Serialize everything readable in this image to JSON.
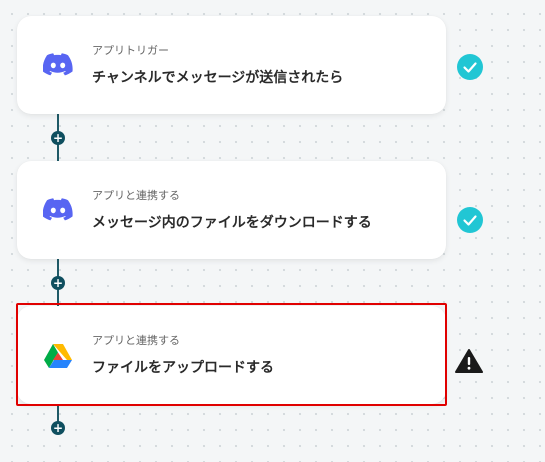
{
  "steps": [
    {
      "kind": "アプリトリガー",
      "title": "チャンネルでメッセージが送信されたら",
      "app_icon": "discord-icon",
      "status": "check-icon"
    },
    {
      "kind": "アプリと連携する",
      "title": "メッセージ内のファイルをダウンロードする",
      "app_icon": "discord-icon",
      "status": "check-icon"
    },
    {
      "kind": "アプリと連携する",
      "title": "ファイルをアップロードする",
      "app_icon": "google-drive-icon",
      "status": "warning-icon"
    }
  ],
  "add_button_label": "+",
  "colors": {
    "discord": "#5865F2",
    "check": "#21c6d4",
    "connector": "#1f5a67",
    "highlight": "#e00000",
    "warning": "#1a1a1a"
  }
}
